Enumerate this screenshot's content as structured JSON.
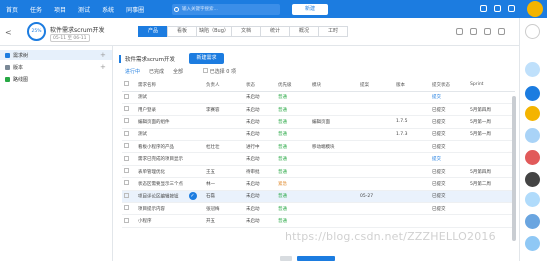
{
  "nav": {
    "items": [
      "首页",
      "任务",
      "项目",
      "测试",
      "系统",
      "同事圈"
    ],
    "search_placeholder": "输入关键字搜索...",
    "new_button": "新建"
  },
  "header": {
    "progress": "25%",
    "title": "软件需求scrum开发",
    "date_range": "05-11 至 06-11",
    "tabs": [
      "产品",
      "看板",
      "缺陷（Bug）",
      "文档",
      "统计",
      "概况",
      "工时"
    ],
    "active_tab": "产品"
  },
  "tree": {
    "items": [
      {
        "label": "需求树"
      },
      {
        "label": "版本"
      },
      {
        "label": "路线图"
      }
    ]
  },
  "main": {
    "section_title": "软件需求scrum开发",
    "add_button": "新建需求",
    "filters": [
      "进行中",
      "已完成",
      "全部"
    ],
    "selected_label": "已选择",
    "selected_count": "0 项",
    "columns": [
      "需求名称",
      "负责人",
      "状态",
      "优先级",
      "模块",
      "提案",
      "版本",
      "提交状态",
      "Sprint"
    ],
    "rows": [
      {
        "name": "测试",
        "owner": "",
        "status": "未启动",
        "priority": "普通",
        "module": "",
        "proposal": "",
        "version": "",
        "submit": "提交",
        "sprint": ""
      },
      {
        "name": "用户登录",
        "owner": "李赛容",
        "status": "未启动",
        "priority": "普通",
        "module": "",
        "proposal": "",
        "version": "",
        "submit": "已提交",
        "sprint": "5月第四周"
      },
      {
        "name": "编辑页面的组件",
        "owner": "",
        "status": "未启动",
        "priority": "普通",
        "module": "编辑页面",
        "proposal": "",
        "version": "1.7.5",
        "submit": "已提交",
        "sprint": "5月第一周"
      },
      {
        "name": "测试",
        "owner": "",
        "status": "未启动",
        "priority": "普通",
        "module": "",
        "proposal": "",
        "version": "1.7.3",
        "submit": "已提交",
        "sprint": "5月第一周"
      },
      {
        "name": "看板小程序的产品",
        "owner": "杜壮壮",
        "status": "进行中",
        "priority": "普通",
        "module": "移动端模块",
        "proposal": "",
        "version": "",
        "submit": "已提交",
        "sprint": ""
      },
      {
        "name": "需求已完成的项目显示",
        "owner": "",
        "status": "未启动",
        "priority": "普通",
        "module": "",
        "proposal": "",
        "version": "",
        "submit": "提交",
        "sprint": ""
      },
      {
        "name": "表单管理优化",
        "owner": "王五",
        "status": "待审批",
        "priority": "普通",
        "module": "",
        "proposal": "",
        "version": "",
        "submit": "已提交",
        "sprint": "5月第四周"
      },
      {
        "name": "状态区需要显示三个点",
        "owner": "林一",
        "status": "未启动",
        "priority": "紧急",
        "module": "",
        "proposal": "",
        "version": "",
        "submit": "已提交",
        "sprint": "5月第二周"
      },
      {
        "name": "项目评论区编辑按钮",
        "owner": "石磊",
        "status": "未启动",
        "priority": "普通",
        "module": "",
        "proposal": "05-27",
        "version": "",
        "submit": "已提交",
        "sprint": ""
      },
      {
        "name": "项目提示内容",
        "owner": "张冠梅",
        "status": "未启动",
        "priority": "普通",
        "module": "",
        "proposal": "",
        "version": "",
        "submit": "已提交",
        "sprint": ""
      },
      {
        "name": "小程序",
        "owner": "开五",
        "status": "未启动",
        "priority": "普通",
        "module": "",
        "proposal": "",
        "version": "",
        "submit": "",
        "sprint": ""
      }
    ],
    "highlight_row": 8
  },
  "watermark": "https://blog.csdn.net/ZZZHELLO2016",
  "colors": {
    "primary": "#1c7ce0",
    "green": "#27a844",
    "orange": "#e08a2c"
  }
}
